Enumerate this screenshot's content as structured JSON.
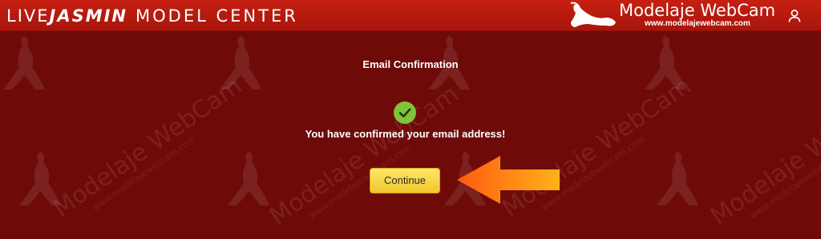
{
  "header": {
    "brand_live": "LIVE",
    "brand_jasmin": "JASMIN",
    "brand_model_center": "MODEL CENTER"
  },
  "watermark_logo": {
    "title": "Modelaje WebCam",
    "url": "www.modelajewebcam.com"
  },
  "watermark_text": {
    "title": "Modelaje WebCam",
    "url": "www.modelajewebcam.com"
  },
  "main": {
    "title": "Email Confirmation",
    "message": "You have confirmed your email address!",
    "continue_label": "Continue"
  },
  "icons": {
    "user": "user-icon",
    "check": "check-icon",
    "arrow": "arrow-icon"
  },
  "colors": {
    "header_bg": "#c61f12",
    "page_bg": "#6e0b09",
    "success": "#7fc33a",
    "button": "#f5d13a",
    "arrow": "#f58a10"
  }
}
